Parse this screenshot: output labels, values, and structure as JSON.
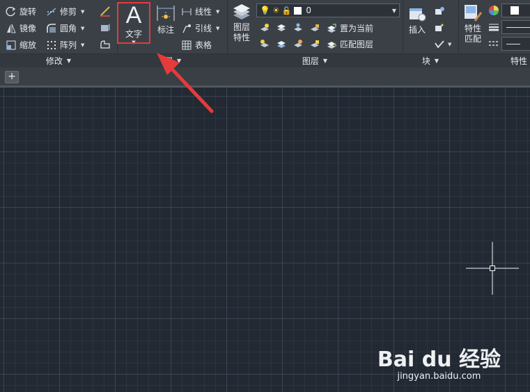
{
  "ribbon": {
    "modify": {
      "items": [
        {
          "label": "旋转",
          "icon": "rotate-icon"
        },
        {
          "label": "修剪",
          "icon": "trim-icon"
        },
        {
          "label": "镜像",
          "icon": "mirror-icon"
        },
        {
          "label": "圆角",
          "icon": "fillet-icon"
        },
        {
          "label": "缩放",
          "icon": "scale-icon"
        },
        {
          "label": "阵列",
          "icon": "array-icon"
        }
      ],
      "title": "修改"
    },
    "annotation": {
      "text_btn": "文字",
      "dim_btn": "标注",
      "linear": "线性",
      "leader": "引线",
      "table": "表格",
      "title_fragment": "释"
    },
    "layers": {
      "props_btn_line1": "图层",
      "props_btn_line2": "特性",
      "current_layer": "0",
      "set_current": "置为当前",
      "match_layer": "匹配图层",
      "title": "图层"
    },
    "block": {
      "insert_btn": "插入",
      "title": "块"
    },
    "properties": {
      "match_btn_line1": "特性",
      "match_btn_line2": "匹配",
      "title": "特性"
    }
  },
  "colors": {
    "ribbon_bg": "#3b4047",
    "canvas_bg": "#222933",
    "highlight": "#e53b3b",
    "arrow": "#e53b3b"
  },
  "tabbar": {
    "new_tab": "+"
  },
  "watermark": {
    "logo": "Bai du 经验",
    "url": "jingyan.baidu.com"
  }
}
